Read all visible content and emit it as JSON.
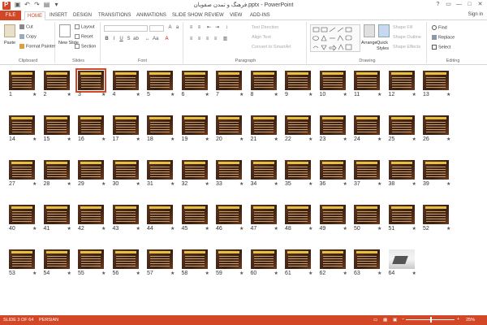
{
  "window": {
    "title": "فرهنگ و تمدن صفویان.pptx - PowerPoint",
    "controls": [
      "?",
      "▭",
      "—",
      "□",
      "✕"
    ]
  },
  "ribbon": {
    "tabs": [
      "FILE",
      "HOME",
      "INSERT",
      "DESIGN",
      "TRANSITIONS",
      "ANIMATIONS",
      "SLIDE SHOW",
      "REVIEW",
      "VIEW",
      "ADD-INS"
    ],
    "active_tab": "HOME",
    "sign_in": "Sign in",
    "clipboard": {
      "label": "Clipboard",
      "paste": "Paste",
      "cut": "Cut",
      "copy": "Copy",
      "format_painter": "Format Painter"
    },
    "slides": {
      "label": "Slides",
      "new_slide": "New Slide",
      "layout": "Layout",
      "reset": "Reset",
      "section": "Section"
    },
    "font": {
      "label": "Font"
    },
    "paragraph": {
      "label": "Paragraph",
      "text_direction": "Text Direction",
      "align_text": "Align Text",
      "convert_smartart": "Convert to SmartArt"
    },
    "drawing": {
      "label": "Drawing",
      "arrange": "Arrange",
      "quick_styles": "Quick Styles",
      "shape_fill": "Shape Fill",
      "shape_outline": "Shape Outline",
      "shape_effects": "Shape Effects"
    },
    "editing": {
      "label": "Editing",
      "find": "Find",
      "replace": "Replace",
      "select": "Select"
    }
  },
  "slides": {
    "selected": 3,
    "photo_slide": 64,
    "numbers": [
      "1",
      "2",
      "3",
      "4",
      "5",
      "6",
      "7",
      "8",
      "9",
      "10",
      "11",
      "12",
      "13",
      "14",
      "15",
      "16",
      "17",
      "18",
      "19",
      "20",
      "21",
      "22",
      "23",
      "24",
      "25",
      "26",
      "27",
      "28",
      "29",
      "30",
      "31",
      "32",
      "33",
      "34",
      "35",
      "36",
      "37",
      "38",
      "39",
      "40",
      "41",
      "42",
      "43",
      "44",
      "45",
      "46",
      "47",
      "48",
      "49",
      "50",
      "51",
      "52",
      "53",
      "54",
      "55",
      "56",
      "57",
      "58",
      "59",
      "60",
      "61",
      "62",
      "63",
      "64"
    ],
    "star": "★"
  },
  "status": {
    "slide_info": "SLIDE 3 OF 64",
    "language": "PERSIAN",
    "zoom": "25%",
    "zoom_fraction": 0.25
  },
  "colors": {
    "accent": "#d24726"
  }
}
